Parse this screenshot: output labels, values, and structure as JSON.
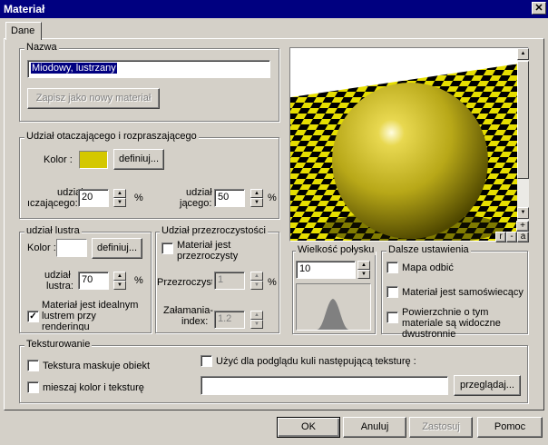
{
  "window": {
    "title": "Materiał",
    "close": "✕"
  },
  "tab": {
    "label": "Dane"
  },
  "nazwa": {
    "group": "Nazwa",
    "value": "Miodowy, lustrzany",
    "save_btn": "Zapisz jako nowy materiał"
  },
  "ambient": {
    "group": "Udział otaczającego i rozpraszającego",
    "color_label": "Kolor :",
    "color": "#d4c800",
    "define_btn": "definiuj...",
    "share1_label1": "udział",
    "share1_label2": "ıczającego:",
    "share1_value": "20",
    "share2_label1": "udział",
    "share2_label2": "jącego:",
    "share2_value": "50",
    "pct": "%"
  },
  "mirror": {
    "group": "udział lustra",
    "color_label": "Kolor :",
    "define_btn": "definiuj...",
    "share_label1": "udział",
    "share_label2": "lustra:",
    "share_value": "70",
    "pct": "%",
    "ideal_label": "Materiał jest idealnym lustrem przy renderingu",
    "ideal_checked": "✓"
  },
  "transparency": {
    "group": "Udział przezroczystości",
    "transparent_label": "Materiał jest przezroczysty",
    "transp_label": "Przezroczysto",
    "transp_value": "1",
    "pct": "%",
    "refr_label1": "Załamania-",
    "refr_label2": "index:",
    "refr_value": "1.2"
  },
  "preview": {
    "buttons": [
      "r",
      "-",
      "a"
    ],
    "plus": "+"
  },
  "shine": {
    "group": "Wielkość połysku",
    "value": "10"
  },
  "further": {
    "group": "Dalsze ustawienia",
    "reflection_map": "Mapa odbić",
    "self_lit": "Materiał jest samoświecący",
    "two_sided": "Powierzchnie o tym materiale są widoczne dwustronnie"
  },
  "texture": {
    "group": "Teksturowanie",
    "masks": "Tekstura maskuje obiekt",
    "mix": "mieszaj kolor i teksturę",
    "use_preview": "Użyć dla podglądu kuli następującą teksturę :",
    "path": "",
    "browse_btn": "przeglądaj..."
  },
  "footer": {
    "ok": "OK",
    "cancel": "Anuluj",
    "apply": "Zastosuj",
    "help": "Pomoc"
  }
}
